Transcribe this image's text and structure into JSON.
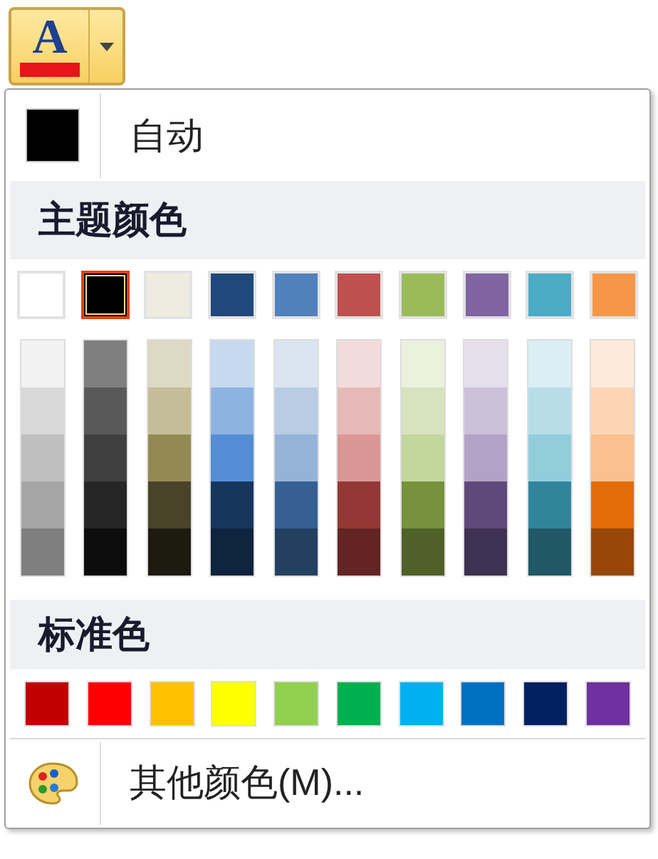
{
  "button": {
    "letter": "A",
    "color": "#e8141c"
  },
  "automatic": {
    "label": "自动",
    "color": "#000000"
  },
  "theme_colors": {
    "title": "主题颜色",
    "base": [
      {
        "color": "#ffffff",
        "selected": false
      },
      {
        "color": "#000000",
        "selected": true
      },
      {
        "color": "#eeece1",
        "selected": false
      },
      {
        "color": "#1f497d",
        "selected": false
      },
      {
        "color": "#4f81bd",
        "selected": false
      },
      {
        "color": "#c0504d",
        "selected": false
      },
      {
        "color": "#9bbb59",
        "selected": false
      },
      {
        "color": "#8064a2",
        "selected": false
      },
      {
        "color": "#4bacc6",
        "selected": false
      },
      {
        "color": "#f79646",
        "selected": false
      }
    ],
    "shades": [
      {
        "swatches": [
          {
            "color": "#f2f2f2"
          },
          {
            "color": "#d8d8d8"
          },
          {
            "color": "#bfbfbf"
          },
          {
            "color": "#a5a5a5"
          },
          {
            "color": "#7f7f7f"
          }
        ]
      },
      {
        "swatches": [
          {
            "color": "#7f7f7f"
          },
          {
            "color": "#595959"
          },
          {
            "color": "#3f3f3f"
          },
          {
            "color": "#262626"
          },
          {
            "color": "#0c0c0c"
          }
        ]
      },
      {
        "swatches": [
          {
            "color": "#ddd9c3"
          },
          {
            "color": "#c4bd97"
          },
          {
            "color": "#938953"
          },
          {
            "color": "#494429"
          },
          {
            "color": "#1d1b10"
          }
        ]
      },
      {
        "swatches": [
          {
            "color": "#c6d9f0"
          },
          {
            "color": "#8db3e2"
          },
          {
            "color": "#548dd4"
          },
          {
            "color": "#17365d"
          },
          {
            "color": "#0f243e"
          }
        ]
      },
      {
        "swatches": [
          {
            "color": "#dbe5f1"
          },
          {
            "color": "#b8cce4"
          },
          {
            "color": "#95b3d7"
          },
          {
            "color": "#366092"
          },
          {
            "color": "#244061"
          }
        ]
      },
      {
        "swatches": [
          {
            "color": "#f2dcdb"
          },
          {
            "color": "#e5b9b7"
          },
          {
            "color": "#d99694"
          },
          {
            "color": "#953734"
          },
          {
            "color": "#632423"
          }
        ]
      },
      {
        "swatches": [
          {
            "color": "#ebf1dd"
          },
          {
            "color": "#d7e3bc"
          },
          {
            "color": "#c3d69b"
          },
          {
            "color": "#76923c"
          },
          {
            "color": "#4f6128"
          }
        ]
      },
      {
        "swatches": [
          {
            "color": "#e5e0ec"
          },
          {
            "color": "#ccc1d9"
          },
          {
            "color": "#b2a2c7"
          },
          {
            "color": "#5f497a"
          },
          {
            "color": "#3f3151"
          }
        ]
      },
      {
        "swatches": [
          {
            "color": "#dbeef3"
          },
          {
            "color": "#b7dde8"
          },
          {
            "color": "#92cddc"
          },
          {
            "color": "#31859b"
          },
          {
            "color": "#205867"
          }
        ]
      },
      {
        "swatches": [
          {
            "color": "#fdeada"
          },
          {
            "color": "#fbd5b5"
          },
          {
            "color": "#fac08f"
          },
          {
            "color": "#e36c09"
          },
          {
            "color": "#974806"
          }
        ]
      }
    ]
  },
  "standard_colors": {
    "title": "标准色",
    "swatches": [
      {
        "color": "#c00000"
      },
      {
        "color": "#ff0000"
      },
      {
        "color": "#ffc000"
      },
      {
        "color": "#ffff00"
      },
      {
        "color": "#92d050"
      },
      {
        "color": "#00b050"
      },
      {
        "color": "#00b0f0"
      },
      {
        "color": "#0070c0"
      },
      {
        "color": "#002060"
      },
      {
        "color": "#7030a0"
      }
    ]
  },
  "more_colors": {
    "label": "其他颜色(M)..."
  }
}
